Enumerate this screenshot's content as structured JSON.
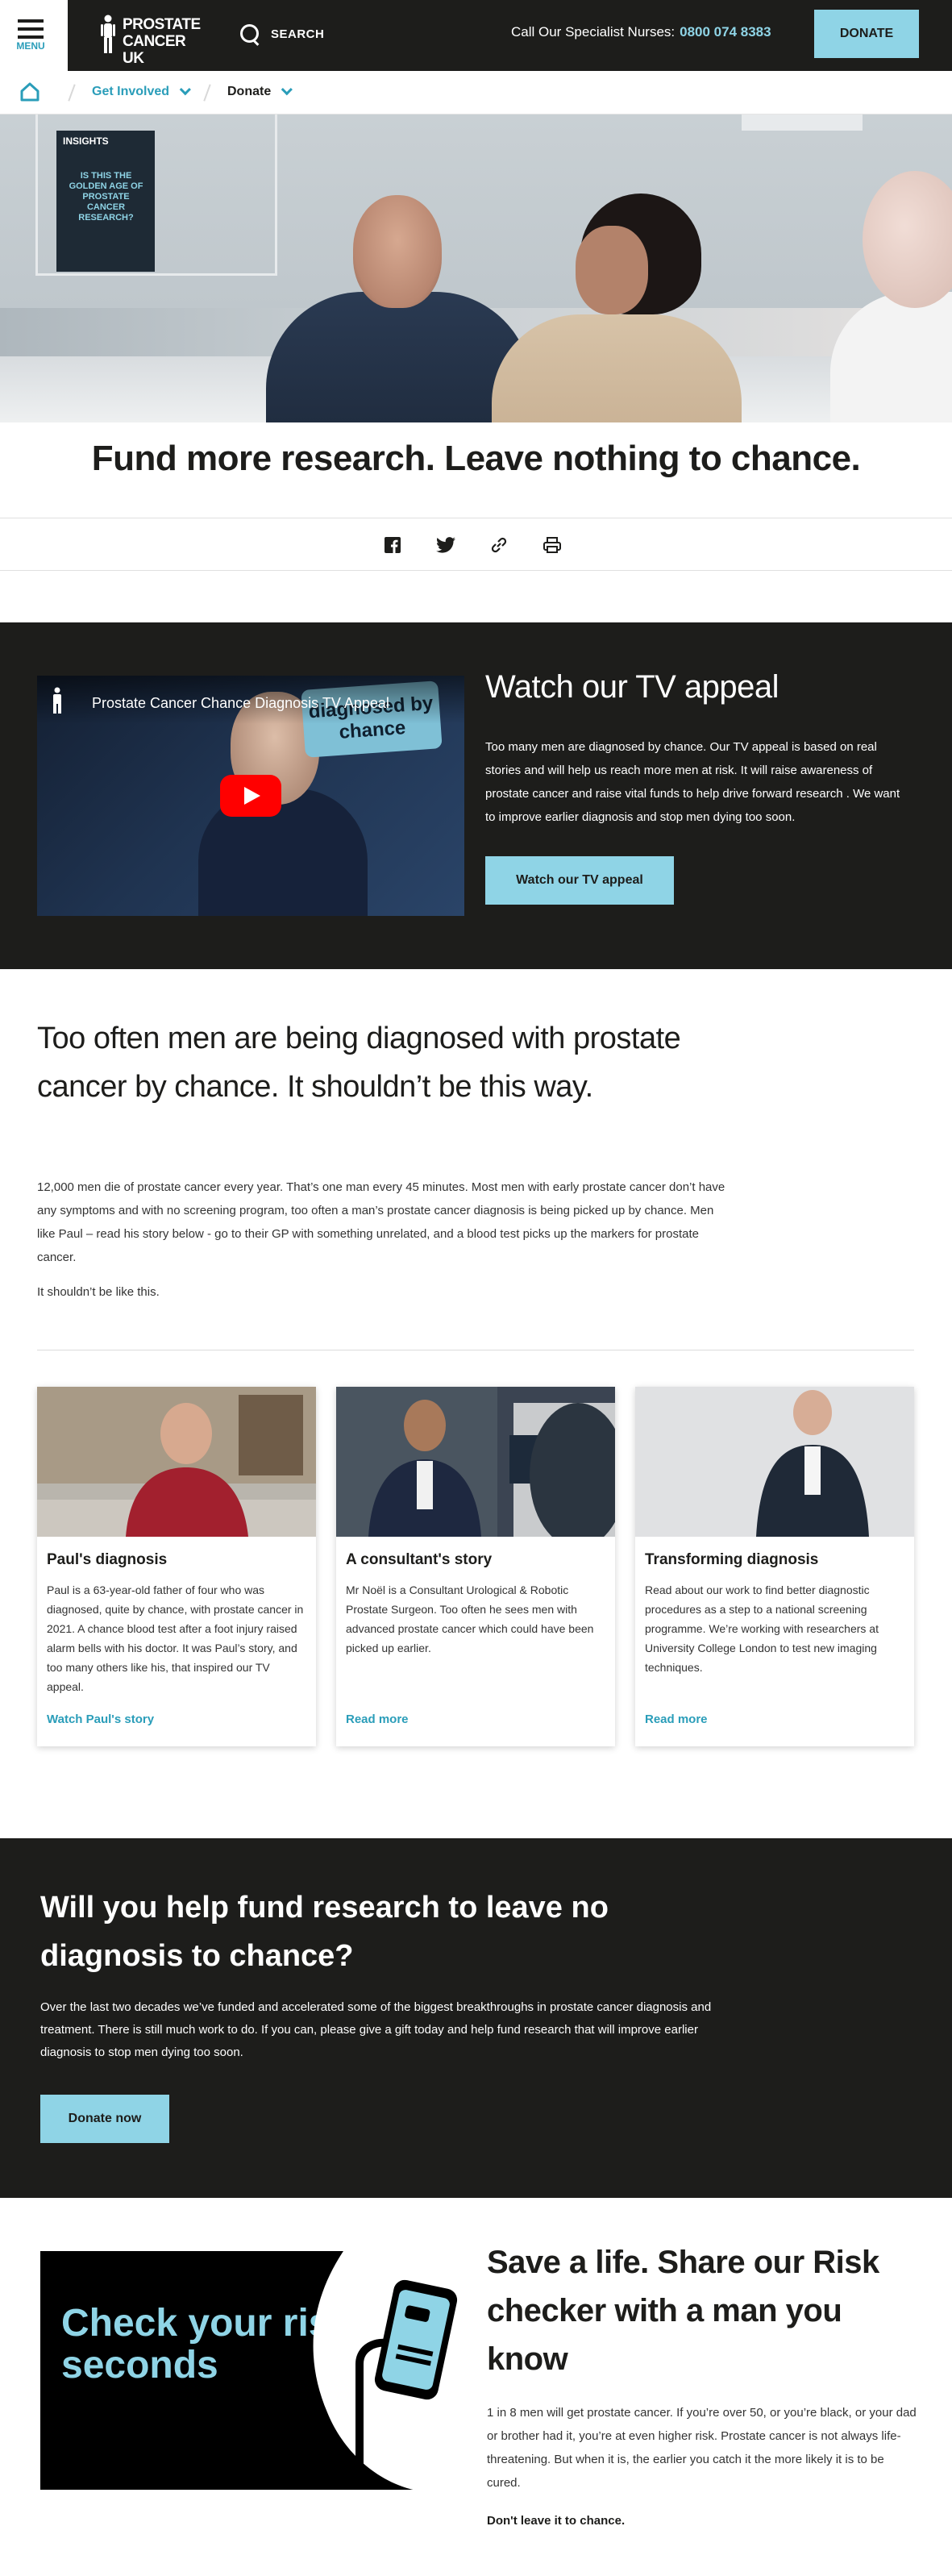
{
  "header": {
    "menu_label": "MENU",
    "logo_line1": "PROSTATE",
    "logo_line2": "CANCER UK",
    "search_label": "SEARCH",
    "nurses_label": "Call Our Specialist Nurses:",
    "nurses_phone": "0800 074 8383",
    "donate_label": "DONATE"
  },
  "breadcrumb": {
    "item1": "Get Involved",
    "item2": "Donate"
  },
  "hero": {
    "poster_label": "INSIGHTS",
    "poster_text": "IS THIS THE GOLDEN AGE OF PROSTATE CANCER RESEARCH?"
  },
  "page_title": "Fund more research. Leave nothing to chance.",
  "tv_appeal": {
    "video_title": "Prostate Cancer Chance Diagnosis TV Appeal",
    "video_sign": "diagnosed by chance",
    "heading": "Watch our TV appeal",
    "text": "Too many men are diagnosed by chance. Our TV appeal is based on real stories and will help us reach more men at risk. It will raise awareness of prostate cancer and raise vital funds to help drive forward research . We want to improve earlier diagnosis and stop men dying too soon.",
    "button": "Watch our TV appeal"
  },
  "too_often": {
    "heading": "Too often men are being diagnosed with prostate cancer by chance. It shouldn’t be this way.",
    "text": "12,000 men die of prostate cancer every year. That’s one man every 45 minutes. Most men with early prostate cancer don’t have any symptoms and with no screening program, too often a man’s prostate cancer diagnosis is being picked up by chance. Men like Paul – read his story below - go to their GP with something unrelated, and a blood test picks up the markers for prostate cancer.",
    "text2": "It shouldn’t be like this."
  },
  "cards": [
    {
      "title": "Paul's diagnosis",
      "text": "Paul is a 63-year-old father of four who was diagnosed, quite by chance, with prostate cancer in 2021. A chance blood test after a foot injury raised alarm bells with his doctor. It was Paul’s story, and too many others like his, that inspired our TV appeal.",
      "link": "Watch Paul's story"
    },
    {
      "title": "A consultant's story",
      "text": "Mr Noël is a Consultant Urological & Robotic Prostate Surgeon. Too often he sees men with advanced prostate cancer which could have been picked up earlier.",
      "link": "Read more"
    },
    {
      "title": "Transforming diagnosis",
      "text": "Read about our work to find better diagnostic procedures as a step to a national screening programme. We’re working with researchers at University College London to test new imaging techniques.",
      "link": "Read more"
    }
  ],
  "fund": {
    "heading": "Will you help fund research to leave no diagnosis to chance?",
    "text": "Over the last two decades we’ve funded and accelerated some of the biggest breakthroughs in prostate cancer diagnosis and treatment. There is still much work to do. If you can, please give a gift today and help fund research that will improve earlier diagnosis to stop men dying too soon.",
    "button": "Donate now"
  },
  "risk": {
    "image_text": "Check your risk in 30 seconds",
    "heading": "Save a life. Share our Risk checker with a man you know",
    "text": "1 in 8 men will get prostate cancer. If you’re over 50, or you’re black, or your dad or brother had it, you’re at even higher risk. Prostate cancer is not always life-threatening. But when it is, the earlier you catch it the more likely it is to be cured.",
    "strong": "Don't leave it to chance."
  },
  "colors": {
    "accent": "#8fd4e6",
    "link": "#2a9db9",
    "dark": "#1d1d1b"
  }
}
